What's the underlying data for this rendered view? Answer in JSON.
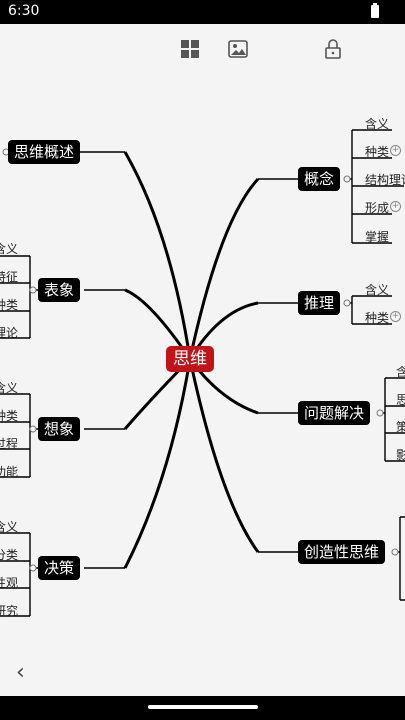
{
  "status": {
    "time": "6:30"
  },
  "toolbar": {
    "icons": [
      "grid-icon",
      "image-icon",
      "lock-icon"
    ]
  },
  "center": {
    "label": "思维"
  },
  "left_topics": {
    "t1": {
      "label": "思维概述"
    },
    "t2": {
      "label": "表象",
      "children": [
        "含义",
        "特征",
        "种类",
        "理论"
      ]
    },
    "t3": {
      "label": "想象",
      "children": [
        "含义",
        "种类",
        "过程",
        "功能"
      ]
    },
    "t4": {
      "label": "决策",
      "children": [
        "含义",
        "分类",
        "性观",
        "研究"
      ]
    }
  },
  "right_topics": {
    "t1": {
      "label": "概念",
      "children": [
        "含义",
        "种类",
        "结构理论",
        "形成",
        "掌握"
      ]
    },
    "t2": {
      "label": "推理",
      "children": [
        "含义",
        "种类"
      ]
    },
    "t3": {
      "label": "问题解决",
      "children": [
        "含",
        "思",
        "策",
        "影"
      ]
    },
    "t4": {
      "label": "创造性思维"
    }
  },
  "nav": {
    "back": "‹"
  }
}
